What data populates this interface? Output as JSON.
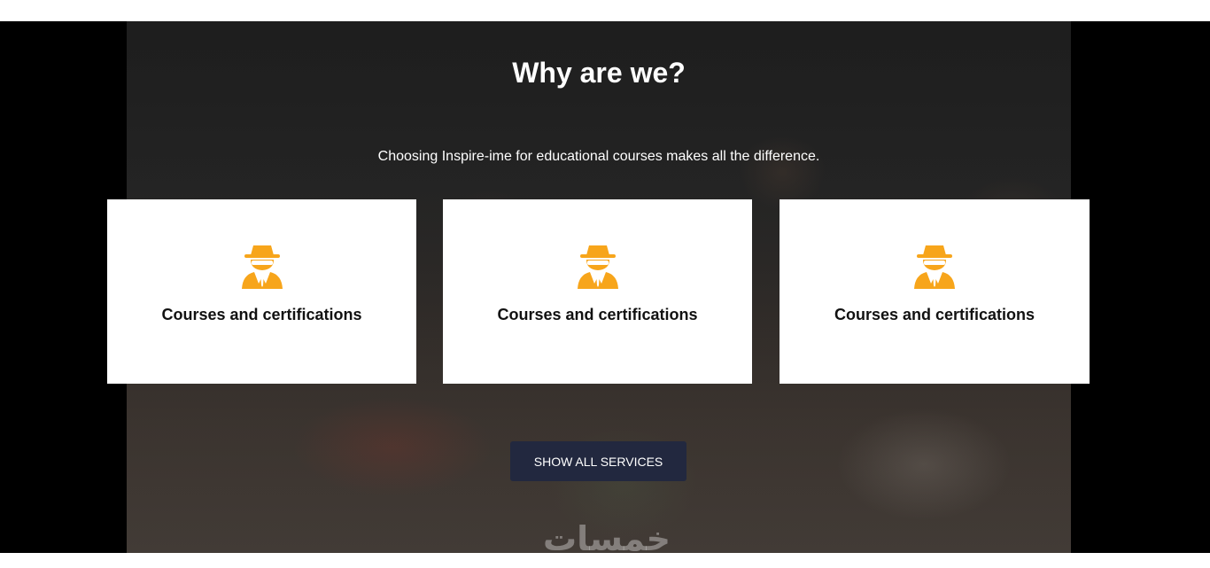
{
  "section": {
    "title": "Why are we?",
    "subtitle": "Choosing Inspire-ime for educational courses makes all the difference."
  },
  "cards": [
    {
      "icon": "spy-agent-icon",
      "label": "Courses and certifications"
    },
    {
      "icon": "spy-agent-icon",
      "label": "Courses and certifications"
    },
    {
      "icon": "spy-agent-icon",
      "label": "Courses and certifications"
    }
  ],
  "cta": {
    "label": "SHOW ALL SERVICES"
  },
  "watermark": {
    "text": "خمسات"
  },
  "colors": {
    "accent_icon": "#f7a51b",
    "button_bg": "#22283f",
    "card_bg": "#ffffff",
    "hero_bg": "#2a2a2a"
  }
}
